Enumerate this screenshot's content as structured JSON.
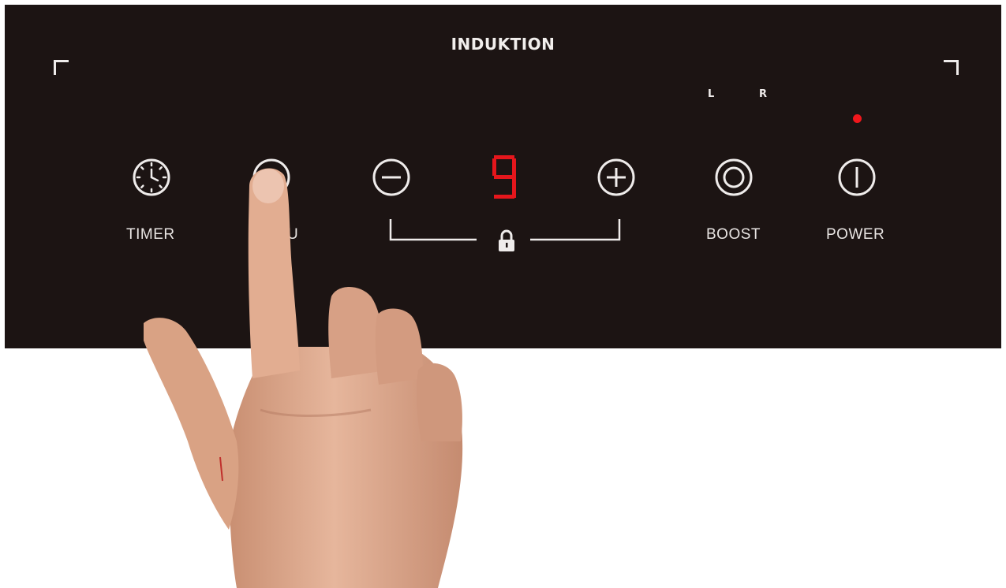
{
  "panel": {
    "title": "INDUKTION",
    "zone_left": "L",
    "zone_right": "R",
    "power_display": "9",
    "timer_label": "TIMER",
    "menu_label_visible": "U",
    "boost_label": "BOOST",
    "power_label": "POWER",
    "colors": {
      "panel": "#1c1413",
      "text": "#f2efed",
      "display_red": "#e5161c",
      "indicator_led": "#f0171c"
    },
    "icons": [
      "clock-icon",
      "ring-icon",
      "minus-icon",
      "plus-icon",
      "lock-icon",
      "boost-icon",
      "power-icon",
      "corner-mark-icon"
    ]
  }
}
